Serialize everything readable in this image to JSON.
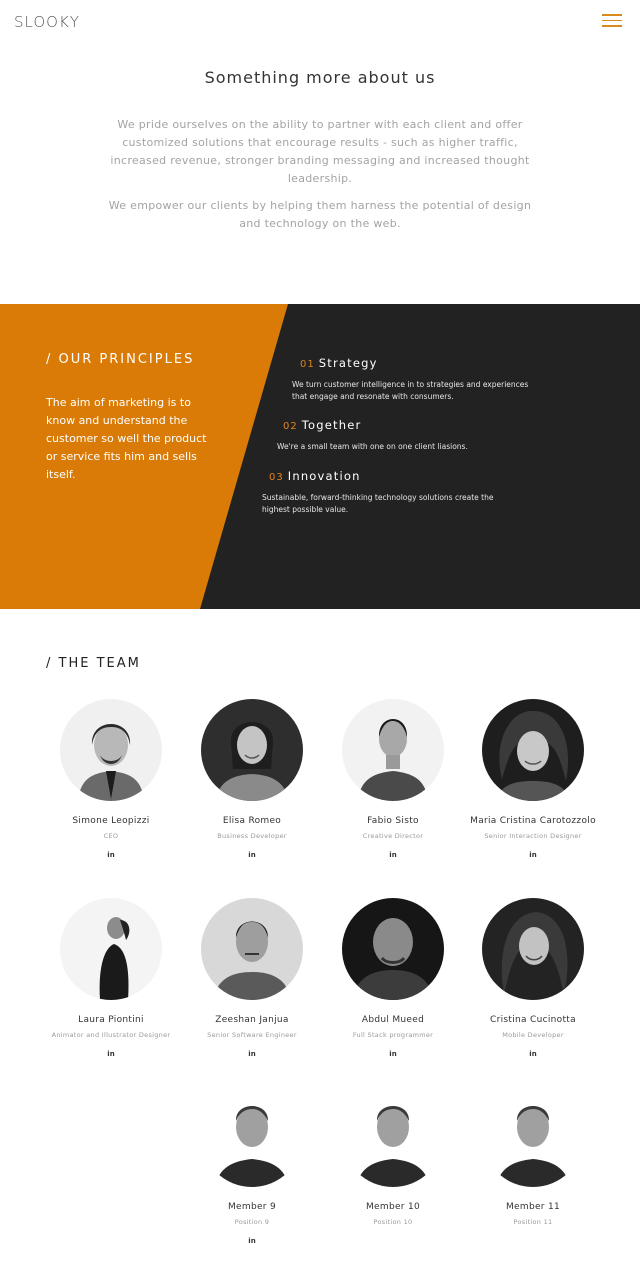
{
  "header": {
    "logo": "SLOOKY",
    "menu_icon": "hamburger-icon",
    "accent": "#d98a1c"
  },
  "about": {
    "title": "Something more about us",
    "paragraph1": "We pride ourselves on the ability to partner with each client and offer customized solutions that encourage results - such as higher traffic, increased revenue, stronger branding messaging and increased thought leadership.",
    "paragraph2": "We empower our clients by helping them harness the potential of design and technology on the web."
  },
  "principles": {
    "title": "/ OUR PRINCIPLES",
    "text": "The aim of marketing is to know and understand the customer so well the product or service fits him and sells itself.",
    "orange_color": "#d97b06",
    "dark_color": "#222222",
    "items": [
      {
        "num": "01",
        "name": "Strategy",
        "desc": "We turn customer intelligence in to strategies and experiences that engage and resonate with consumers."
      },
      {
        "num": "02",
        "name": "Together",
        "desc": "We're a small team with one on one client liasions."
      },
      {
        "num": "03",
        "name": "Innovation",
        "desc": "Sustainable, forward-thinking technology solutions create the highest possible value."
      }
    ]
  },
  "team": {
    "title": "/ THE TEAM",
    "linkedin_label": "in",
    "members": [
      {
        "name": "Simone Leopizzi",
        "role": "CEO",
        "has_link": true
      },
      {
        "name": "Elisa Romeo",
        "role": "Business Developer",
        "has_link": true
      },
      {
        "name": "Fabio Sisto",
        "role": "Creative Director",
        "has_link": true
      },
      {
        "name": "Maria Cristina Carotozzolo",
        "role": "Senior Interaction Designer",
        "has_link": true
      },
      {
        "name": "Laura Piontini",
        "role": "Animator and Illustrator Designer",
        "has_link": true
      },
      {
        "name": "Zeeshan Janjua",
        "role": "Senior Software Engineer",
        "has_link": true
      },
      {
        "name": "Abdul Mueed",
        "role": "Full Stack programmer",
        "has_link": true
      },
      {
        "name": "Cristina Cucinotta",
        "role": "Mobile Developer",
        "has_link": true
      },
      {
        "name": "Member 9",
        "role": "Position 9",
        "has_link": true
      },
      {
        "name": "Member 10",
        "role": "Position 10",
        "has_link": false
      },
      {
        "name": "Member 11",
        "role": "Position 11",
        "has_link": false
      }
    ]
  }
}
